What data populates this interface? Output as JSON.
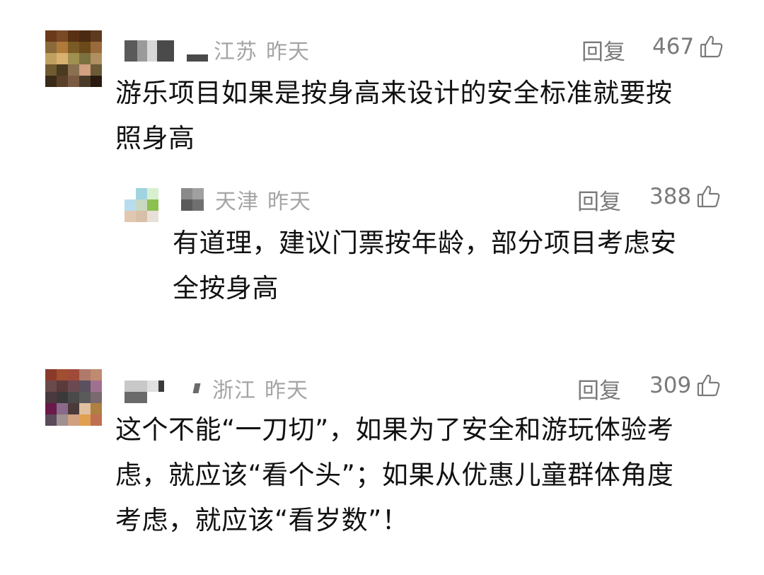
{
  "comments": [
    {
      "location": "江苏",
      "time": "昨天",
      "reply_label": "回复",
      "likes": "467",
      "text_lines": [
        "游乐项目如果是按身高来设计的安全标准就要按",
        "照身高"
      ],
      "avatar_colors": [
        "#6b3a1a",
        "#7a4a25",
        "#5a3015",
        "#4a2a12",
        "#5e3a1e",
        "#8a6a3a",
        "#b07a3a",
        "#7a5a25",
        "#6a4a1a",
        "#9a6a3a",
        "#c0a060",
        "#d8b070",
        "#a09050",
        "#7a7040",
        "#b09060",
        "#705a30",
        "#4a3a20",
        "#8a7050",
        "#d0a080",
        "#6a5a38",
        "#3a2a18",
        "#5a4028",
        "#7a5a40",
        "#4a3a28",
        "#2a1a10"
      ]
    },
    {
      "location": "天津",
      "time": "昨天",
      "reply_label": "回复",
      "likes": "388",
      "text_lines": [
        "有道理，建议门票按年龄，部分项目考虑安",
        "全按身高"
      ],
      "avatar_colors": [
        "#ffffff",
        "#9fd4e0",
        "#d8f0d0",
        "#b8dcef",
        "#c8d8c0",
        "#8cc050",
        "#e0c8b0",
        "#d8c0a8",
        "#e8e0d8"
      ]
    },
    {
      "location": "浙江",
      "time": "昨天",
      "reply_label": "回复",
      "likes": "309",
      "text_lines": [
        "这个不能“一刀切”，如果为了安全和游玩体验考",
        "虑，就应该“看个头”；如果从优惠儿童群体角度",
        "考虑，就应该“看岁数”！"
      ],
      "avatar_colors": [
        "#8a3a2a",
        "#a05030",
        "#a04a3a",
        "#b07a6a",
        "#c08a70",
        "#6a4a4a",
        "#5a3a3a",
        "#6a4a50",
        "#5a5060",
        "#a07090",
        "#4a3a40",
        "#3a3a3a",
        "#4a4a4a",
        "#5a5a5a",
        "#7a6a70",
        "#6a1a4a",
        "#8a6a8a",
        "#4a3a3a",
        "#e0c0a0",
        "#b08040",
        "#5a4a5a",
        "#a09090",
        "#d0a080",
        "#e0a050",
        "#c07050"
      ]
    }
  ]
}
